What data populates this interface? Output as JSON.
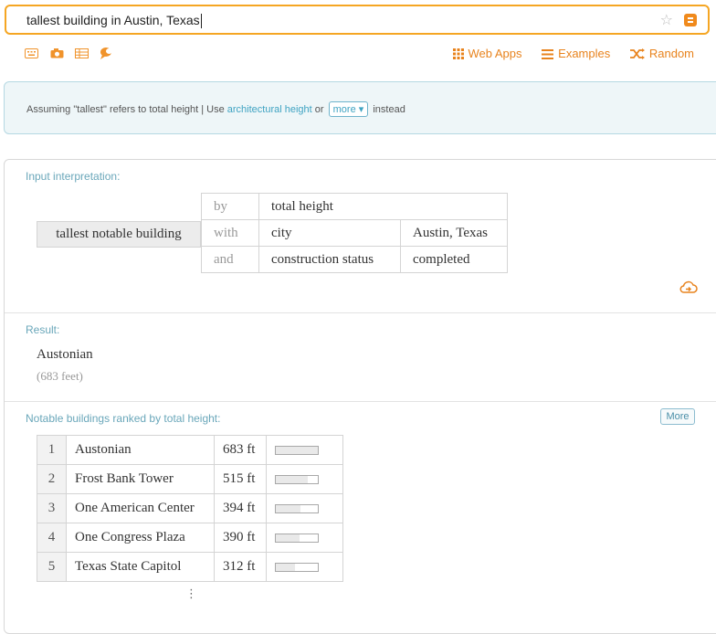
{
  "search": {
    "query": "tallest building in Austin, Texas"
  },
  "toolbar": {
    "web_apps": "Web Apps",
    "examples": "Examples",
    "random": "Random"
  },
  "assumption": {
    "prefix": "Assuming \"tallest\" refers to total height | Use",
    "link": "architectural height",
    "or": "or",
    "more": "more",
    "suffix": "instead"
  },
  "input_interpretation": {
    "title": "Input interpretation:",
    "main": "tallest notable building",
    "rows": [
      {
        "kw": "by",
        "v1": "total height",
        "v2": ""
      },
      {
        "kw": "with",
        "v1": "city",
        "v2": "Austin, Texas"
      },
      {
        "kw": "and",
        "v1": "construction status",
        "v2": "completed"
      }
    ]
  },
  "result": {
    "title": "Result:",
    "name": "Austonian",
    "detail": "(683 feet)"
  },
  "ranking": {
    "title": "Notable buildings ranked by total height:",
    "more": "More",
    "rows": [
      {
        "rank": "1",
        "name": "Austonian",
        "height": "683 ft",
        "fraction": 1.0
      },
      {
        "rank": "2",
        "name": "Frost Bank Tower",
        "height": "515 ft",
        "fraction": 0.754
      },
      {
        "rank": "3",
        "name": "One American Center",
        "height": "394 ft",
        "fraction": 0.577
      },
      {
        "rank": "4",
        "name": "One Congress Plaza",
        "height": "390 ft",
        "fraction": 0.571
      },
      {
        "rank": "5",
        "name": "Texas State Capitol",
        "height": "312 ft",
        "fraction": 0.457
      }
    ],
    "ellipsis": "⋮"
  },
  "icons": {
    "keyboard": "keyboard-icon",
    "camera": "camera-icon",
    "table": "table-icon",
    "speech": "speech-icon",
    "grid": "grid-icon",
    "list": "list-icon",
    "shuffle": "shuffle-icon",
    "cloud_save": "cloud-save-icon"
  },
  "colors": {
    "accent": "#f5a623",
    "link": "#3fa3c2",
    "pod_title": "#6aa7ba"
  }
}
